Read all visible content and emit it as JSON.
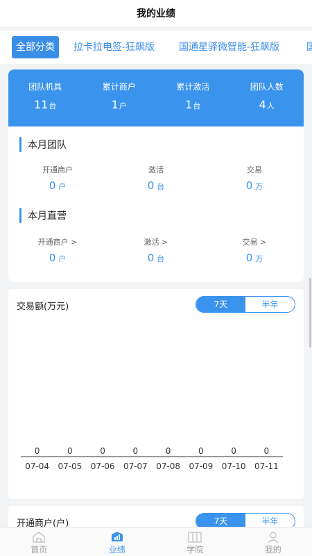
{
  "header": {
    "title": "我的业绩"
  },
  "tabs": [
    {
      "label": "全部分类",
      "active": true
    },
    {
      "label": "拉卡拉电签-狂飙版",
      "active": false
    },
    {
      "label": "国通星驿微智能-狂飙版",
      "active": false
    },
    {
      "label": "国",
      "active": false
    }
  ],
  "summary": [
    {
      "label": "团队机具",
      "value": "11",
      "unit": "台"
    },
    {
      "label": "累计商户",
      "value": "1",
      "unit": "户"
    },
    {
      "label": "累计激活",
      "value": "1",
      "unit": "台"
    },
    {
      "label": "团队人数",
      "value": "4",
      "unit": "人"
    }
  ],
  "team_month": {
    "title": "本月团队",
    "metrics": [
      {
        "label": "开通商户",
        "value": "0",
        "unit": "户"
      },
      {
        "label": "激活",
        "value": "0",
        "unit": "台"
      },
      {
        "label": "交易",
        "value": "0",
        "unit": "万"
      }
    ]
  },
  "direct_month": {
    "title": "本月直营",
    "metrics": [
      {
        "label": "开通商户 >",
        "value": "0",
        "unit": "户"
      },
      {
        "label": "激活 >",
        "value": "0",
        "unit": "台"
      },
      {
        "label": "交易 >",
        "value": "0",
        "unit": "万"
      }
    ]
  },
  "chart_data": {
    "type": "bar",
    "title": "交易额(万元)",
    "categories": [
      "07-04",
      "07-05",
      "07-06",
      "07-07",
      "07-08",
      "07-09",
      "07-10",
      "07-11"
    ],
    "values": [
      0,
      0,
      0,
      0,
      0,
      0,
      0,
      0
    ],
    "toggle": [
      "7天",
      "半年"
    ],
    "active_toggle": "7天",
    "accent": "#3a93ec"
  },
  "merchant_chart": {
    "title": "开通商户(户)",
    "toggle": [
      "7天",
      "半年"
    ]
  },
  "tabbar": [
    {
      "label": "首页",
      "icon": "home-icon",
      "active": false
    },
    {
      "label": "业绩",
      "icon": "performance-icon",
      "active": true
    },
    {
      "label": "学院",
      "icon": "academy-icon",
      "active": false
    },
    {
      "label": "我的",
      "icon": "profile-icon",
      "active": false
    }
  ],
  "colors": {
    "accent": "#3a93ec",
    "background": "#f2f3f5"
  }
}
